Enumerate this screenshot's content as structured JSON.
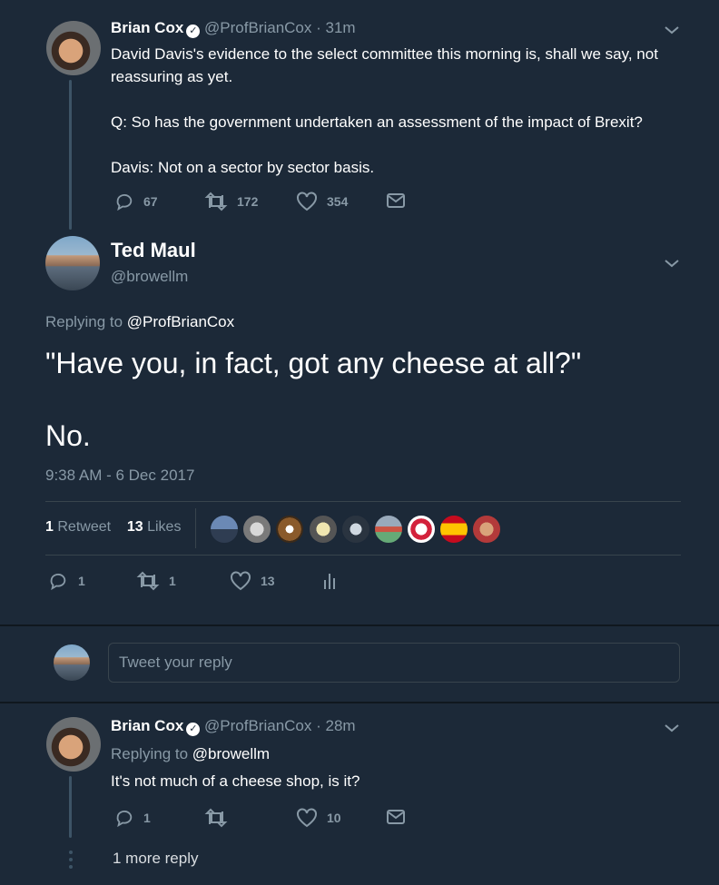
{
  "tweet1": {
    "name": "Brian Cox",
    "handle": "@ProfBrianCox",
    "time": "· 31m",
    "line1": "David Davis's evidence to the select committee this morning is, shall we say, not",
    "line2": "reassuring as yet.",
    "line3": "Q: So has the government undertaken an assessment of the impact of Brexit?",
    "line4": "Davis: Not on a sector by sector basis.",
    "replies": "67",
    "retweets": "172",
    "likes": "354"
  },
  "main": {
    "name": "Ted Maul",
    "handle": "@browellm",
    "replying_prefix": "Replying to ",
    "replying_to": "@ProfBrianCox",
    "text_line1": "\"Have you, in fact, got any cheese at all?\"",
    "text_line2": "No.",
    "timestamp": "9:38 AM - 6 Dec 2017",
    "retweet_count": "1",
    "retweet_label": "Retweet",
    "like_count": "13",
    "like_label": "Likes",
    "action_replies": "1",
    "action_retweets": "1",
    "action_likes": "13"
  },
  "reply_input": {
    "placeholder": "Tweet your reply"
  },
  "tweet2": {
    "name": "Brian Cox",
    "handle": "@ProfBrianCox",
    "time": "· 28m",
    "replying_prefix": "Replying to ",
    "replying_to": "@browellm",
    "text": "It's not much of a cheese shop, is it?",
    "replies": "1",
    "likes": "10",
    "more_replies": "1 more reply"
  },
  "colors": {
    "background": "#1c2938",
    "muted": "#8899a6",
    "thread_line": "#3d5466",
    "separator": "#38444d"
  }
}
